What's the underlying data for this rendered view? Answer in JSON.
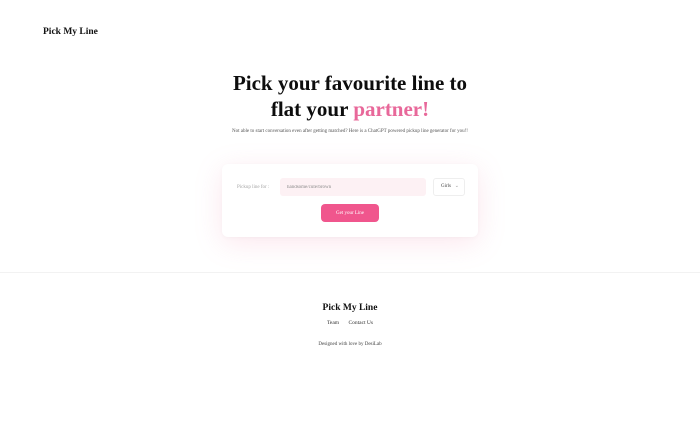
{
  "header": {
    "brand": "Pick My Line"
  },
  "hero": {
    "title_line1": "Pick your favourite line to",
    "title_line2_prefix": "flat your ",
    "title_line2_accent": "partner!",
    "subtitle": "Not able to start conversation even after getting matched? Here is a ChatGPT powered pickup line generator for you!!"
  },
  "form": {
    "label": "Pickup line for :",
    "input_value": "handsome/cute/brown",
    "select_value": "Girls",
    "submit_label": "Get your Line"
  },
  "footer": {
    "brand": "Pick My Line",
    "links": [
      "Team",
      "Contact Us"
    ],
    "credit": "Designed with love by DesiLab"
  },
  "colors": {
    "accent": "#e8689a",
    "button": "#f0568d",
    "input_bg": "#fdf1f4"
  }
}
